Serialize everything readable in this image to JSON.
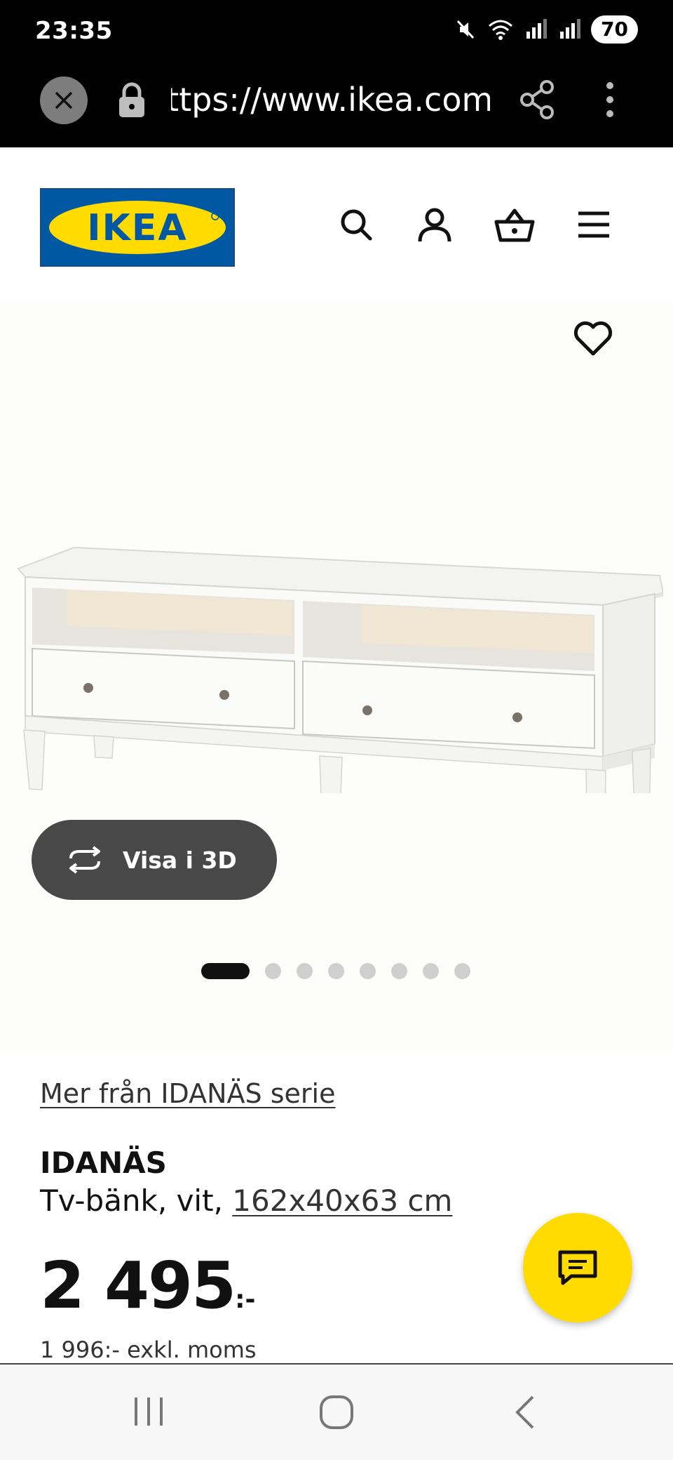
{
  "status_bar": {
    "time": "23:35",
    "battery": "70"
  },
  "browser": {
    "url": "https://www.ikea.com/se/sv/p/idanas-tv-bank-vit"
  },
  "header": {
    "logo_text": "IKEA"
  },
  "gallery": {
    "view3d_label": "Visa i 3D",
    "image_count": 8,
    "active_image": 1
  },
  "product": {
    "series_link": "Mer från IDANÄS serie",
    "name": "IDANÄS",
    "desc_prefix": "Tv-bänk, vit, ",
    "size": "162x40x63 cm",
    "price": "2 495",
    "price_suffix": ":-",
    "price_excl": "1 996:- exkl. moms"
  },
  "colors": {
    "ikea_blue": "#0058a3",
    "ikea_yellow": "#ffdb00",
    "dark_button": "#484848"
  }
}
